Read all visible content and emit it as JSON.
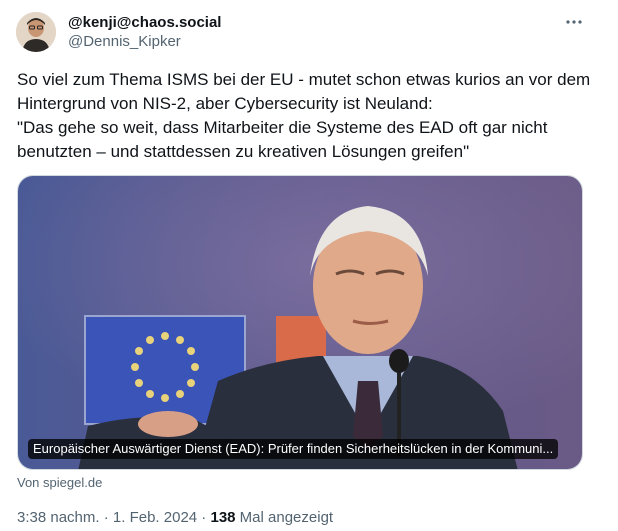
{
  "author": {
    "display_name": "@kenji@chaos.social",
    "handle": "@Dennis_Kipker"
  },
  "tweet": {
    "text": "So viel zum Thema ISMS bei der EU - mutet schon etwas kurios an vor dem Hintergrund von NIS-2, aber Cybersecurity ist Neuland:\n\"Das gehe so weit, dass Mitarbeiter die Systeme des EAD oft gar nicht benutzten – und stattdessen zu kreativen Lösungen greifen\""
  },
  "card": {
    "caption": "Europäischer Auswärtiger Dienst (EAD): Prüfer finden Sicherheitslücken in der Kommuni...",
    "source": "Von spiegel.de"
  },
  "meta": {
    "time": "3:38 nachm.",
    "separator1": " · ",
    "date": "1. Feb. 2024",
    "separator2": " · ",
    "views_count": "138",
    "views_label": " Mal angezeigt"
  },
  "icons": {
    "more": "more-horizontal-icon",
    "avatar": "avatar"
  },
  "colors": {
    "text": "#0f1419",
    "secondary": "#536471",
    "border": "#cfd9de"
  }
}
